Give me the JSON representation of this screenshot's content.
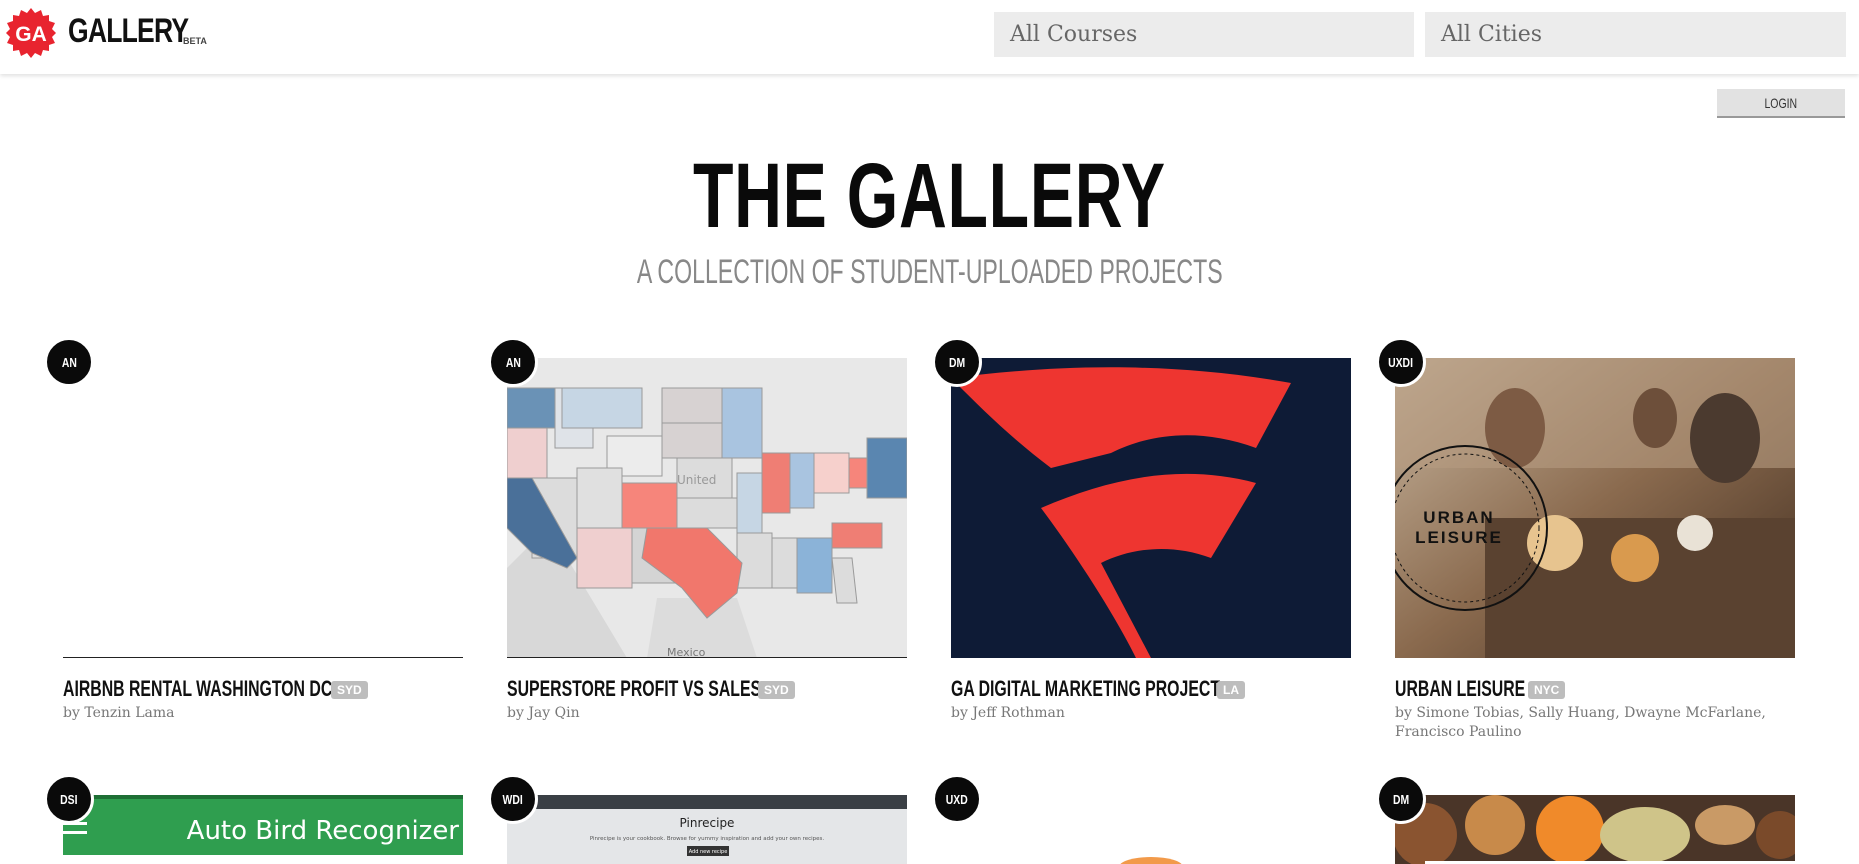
{
  "header": {
    "logo_mark": "GA",
    "logo_text": "GALLERY",
    "logo_tag": "BETA",
    "filters": {
      "courses": "All Courses",
      "cities": "All Cities"
    }
  },
  "login_label": "LOGIN",
  "hero": {
    "title": "THE GALLERY",
    "subtitle": "A COLLECTION OF STUDENT-UPLOADED PROJECTS"
  },
  "projects": [
    {
      "course": "AN",
      "title": "AIRBNB RENTAL WASHINGTON DC",
      "city": "SYD",
      "byline": "by Tenzin Lama"
    },
    {
      "course": "AN",
      "title": "SUPERSTORE PROFIT VS SALES",
      "city": "SYD",
      "byline": "by Jay Qin",
      "thumb_text": "Mexico"
    },
    {
      "course": "DM",
      "title": "GA DIGITAL MARKETING PROJECT",
      "city": "LA",
      "byline": "by Jeff Rothman"
    },
    {
      "course": "UXDI",
      "title": "URBAN LEISURE",
      "city": "NYC",
      "byline": "by Simone Tobias, Sally Huang, Dwayne McFarlane, Francisco Paulino",
      "thumb_text_1": "URBAN",
      "thumb_text_2": "LEISURE"
    },
    {
      "course": "DSI",
      "thumb_text": "Auto Bird Recognizer"
    },
    {
      "course": "WDI",
      "thumb_title": "Pinrecipe",
      "thumb_desc": "Pinrecipe is your cookbook. Browse for yummy inspiration and add your own recipes.",
      "thumb_button": "Add new recipe"
    },
    {
      "course": "UXD"
    },
    {
      "course": "DM"
    }
  ],
  "colors": {
    "accent_red": "#e8242f",
    "badge_black": "#0a0a0a",
    "tag_gray": "#bdbdbd"
  }
}
